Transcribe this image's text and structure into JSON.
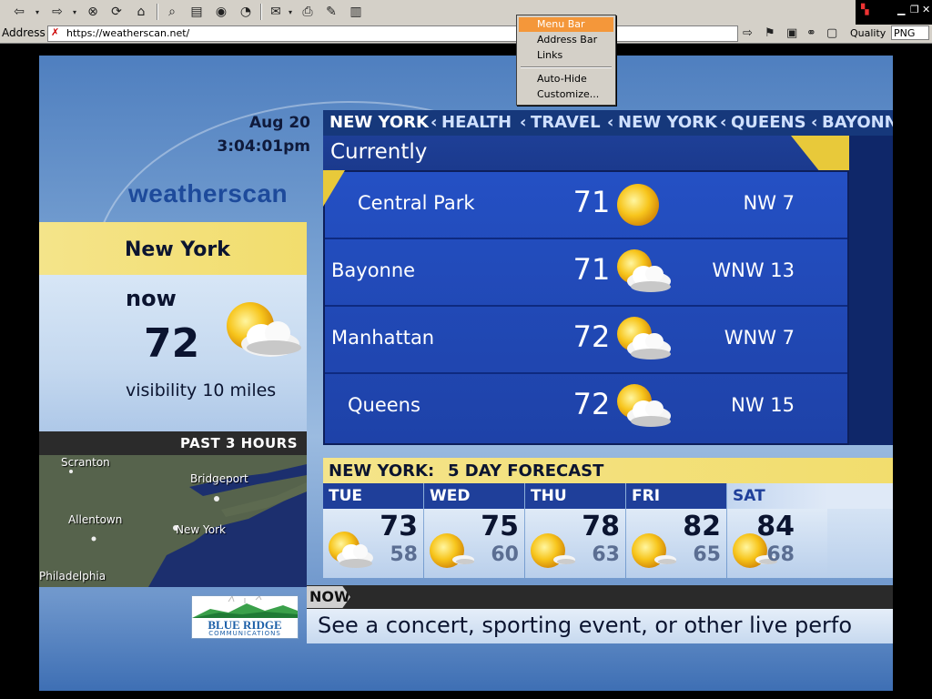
{
  "browser": {
    "address_label": "Address",
    "url": "https://weatherscan.net/",
    "quality_label": "Quality",
    "quality_value": "PNG"
  },
  "context_menu": {
    "items": [
      "Menu Bar",
      "Address Bar",
      "Links",
      "Auto-Hide",
      "Customize..."
    ],
    "highlighted": "Menu Bar",
    "highlight_color": "#f4973a"
  },
  "weather": {
    "date": "Aug 20",
    "time": "3:04:01pm",
    "brand": "weatherscan",
    "city": "New York",
    "now_label": "now",
    "now_temp": "72",
    "now_icon": "partly-cloudy-icon",
    "visibility": "visibility 10 miles",
    "radar_header": "PAST 3 HOURS",
    "radar_labels": [
      "Scranton",
      "Bridgeport",
      "Allentown",
      "New York",
      "Philadelphia"
    ],
    "ticker": [
      "NEW YORK",
      "HEALTH",
      "TRAVEL",
      "NEW YORK",
      "QUEENS",
      "BAYONNE"
    ],
    "currently_title": "Currently",
    "current_rows": [
      {
        "location": "Central Park",
        "temp": "71",
        "icon": "sunny-icon",
        "wind": "NW 7"
      },
      {
        "location": "Bayonne",
        "temp": "71",
        "icon": "partly-cloudy-icon",
        "wind": "WNW 13"
      },
      {
        "location": "Manhattan",
        "temp": "72",
        "icon": "partly-cloudy-icon",
        "wind": "WNW 7"
      },
      {
        "location": "Queens",
        "temp": "72",
        "icon": "partly-cloudy-icon",
        "wind": "NW 15"
      }
    ],
    "forecast_header_city": "NEW YORK:",
    "forecast_header_title": "5 DAY FORECAST",
    "forecast": [
      {
        "day": "TUE",
        "hi": "73",
        "lo": "58",
        "icon": "partly-cloudy-icon"
      },
      {
        "day": "WED",
        "hi": "75",
        "lo": "60",
        "icon": "mostly-sunny-icon"
      },
      {
        "day": "THU",
        "hi": "78",
        "lo": "63",
        "icon": "mostly-sunny-icon"
      },
      {
        "day": "FRI",
        "hi": "82",
        "lo": "65",
        "icon": "mostly-sunny-icon"
      },
      {
        "day": "SAT",
        "hi": "84",
        "lo": "68",
        "icon": "mostly-sunny-icon"
      }
    ],
    "now_tag": "NOW",
    "crawl": "See a concert, sporting event, or other live perfo",
    "sponsor": "BLUE RIDGE",
    "sponsor_sub": "COMMUNICATIONS"
  }
}
